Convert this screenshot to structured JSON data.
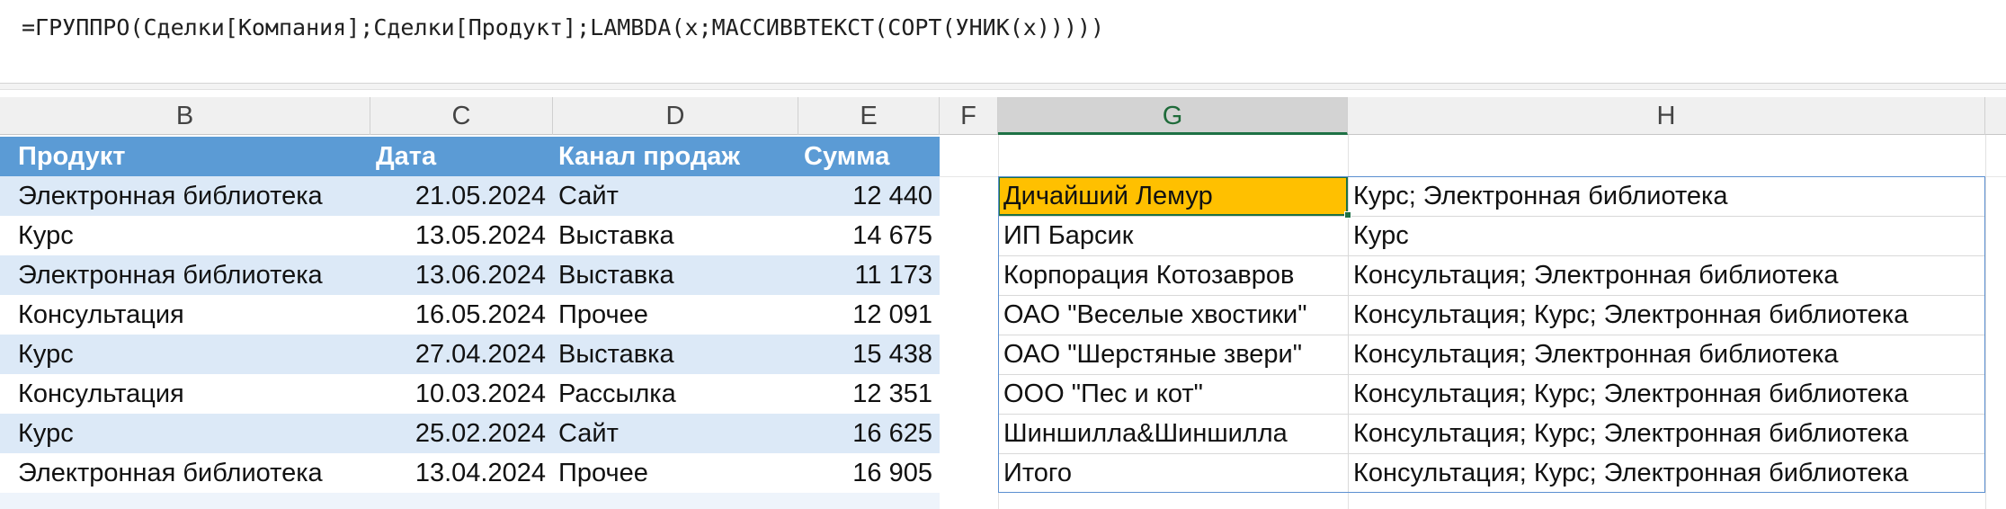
{
  "formula_bar": {
    "formula": "=ГРУППРО(Сделки[Компания];Сделки[Продукт];LAMBDA(x;МАССИВВТЕКСТ(СОРТ(УНИК(x)))))"
  },
  "column_headers": [
    "B",
    "C",
    "D",
    "E",
    "F",
    "G",
    "H"
  ],
  "left_table": {
    "headers": [
      "Продукт",
      "Дата",
      "Канал продаж",
      "Сумма"
    ],
    "rows": [
      [
        "Электронная библиотека",
        "21.05.2024",
        "Сайт",
        "12 440"
      ],
      [
        "Курс",
        "13.05.2024",
        "Выставка",
        "14 675"
      ],
      [
        "Электронная библиотека",
        "13.06.2024",
        "Выставка",
        "11 173"
      ],
      [
        "Консультация",
        "16.05.2024",
        "Прочее",
        "12 091"
      ],
      [
        "Курс",
        "27.04.2024",
        "Выставка",
        "15 438"
      ],
      [
        "Консультация",
        "10.03.2024",
        "Рассылка",
        "12 351"
      ],
      [
        "Курс",
        "25.02.2024",
        "Сайт",
        "16 625"
      ],
      [
        "Электронная библиотека",
        "13.04.2024",
        "Прочее",
        "16 905"
      ]
    ]
  },
  "result_table": {
    "rows": [
      [
        "Дичайший Лемур",
        "Курс; Электронная библиотека"
      ],
      [
        "ИП Барсик",
        "Курс"
      ],
      [
        "Корпорация Котозавров",
        "Консультация; Электронная библиотека"
      ],
      [
        "ОАО \"Веселые хвостики\"",
        "Консультация; Курс; Электронная библиотека"
      ],
      [
        "ОАО \"Шерстяные звери\"",
        "Консультация; Электронная библиотека"
      ],
      [
        "ООО \"Пес и кот\"",
        "Консультация; Курс; Электронная библиотека"
      ],
      [
        "Шиншилла&Шиншилла",
        "Консультация; Курс; Электронная библиотека"
      ],
      [
        "Итого",
        "Консультация; Курс; Электронная библиотека"
      ]
    ]
  },
  "colors": {
    "header_blue": "#5b9bd5",
    "band_blue": "#dce9f7",
    "active_cell": "#ffc000",
    "selection_green": "#1e7145"
  }
}
